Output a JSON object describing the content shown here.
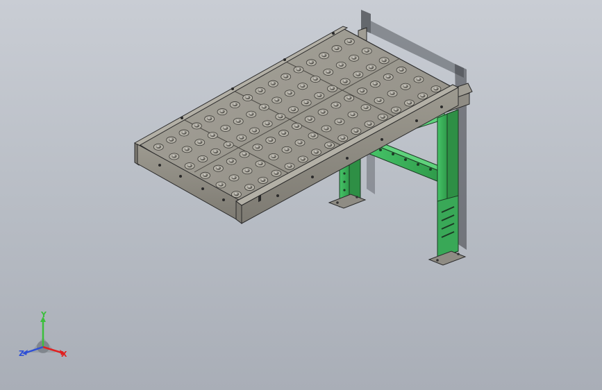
{
  "viewport": {
    "background_top": "#c9cdd4",
    "background_bottom": "#a9aeb7"
  },
  "model": {
    "description_icon": "ball-transfer-conveyor-icon",
    "frame_color": "#8f8c84",
    "frame_edge_color": "#2a2a2a",
    "stand_color": "#3cb25a",
    "ball_color": "#9a9890"
  },
  "triad": {
    "x_label": "X",
    "y_label": "Y",
    "z_label": "Z",
    "x_color": "#e02020",
    "y_color": "#3cbf3c",
    "z_color": "#2e4fd6"
  }
}
